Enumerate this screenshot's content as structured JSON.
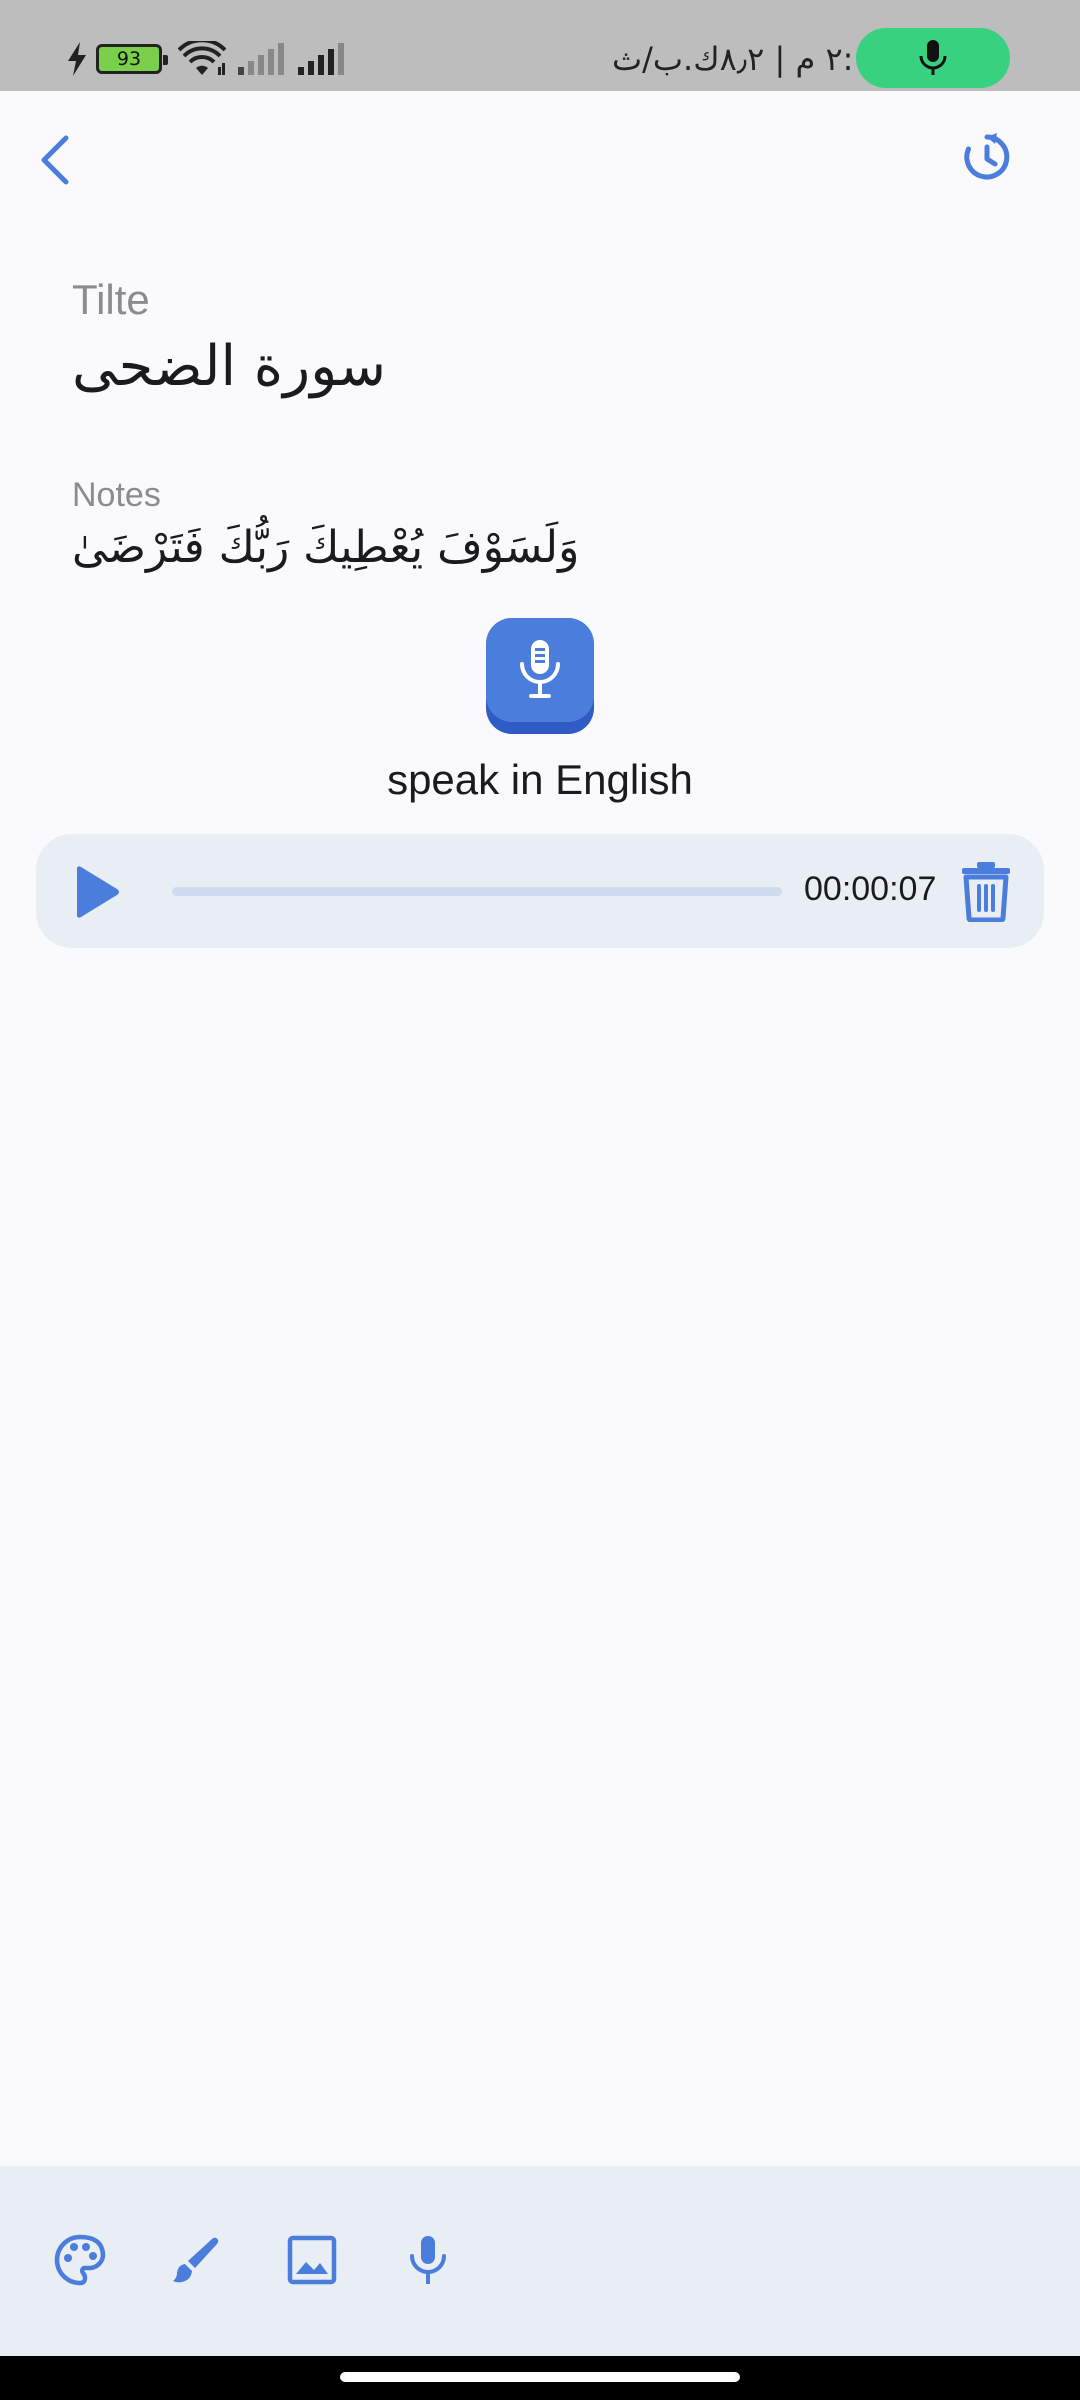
{
  "status_bar": {
    "battery_level": "93",
    "time_text": "٢:١٨ م | ٨٫٢ك.ب/ث",
    "mic_active_color": "#38d180"
  },
  "app_bar": {
    "back_icon": "chevron-left-icon",
    "history_icon": "history-icon"
  },
  "note": {
    "title_label": "Tilte",
    "title_value": "سورة الضحى",
    "notes_label": "Notes",
    "notes_value": "وَلَسَوْفَ يُعْطِيكَ رَبُّكَ فَتَرْضَىٰ"
  },
  "recorder": {
    "speak_label": "speak in English",
    "mic_icon": "microphone-icon"
  },
  "audio_player": {
    "duration": "00:00:07",
    "progress": 0,
    "play_icon": "play-icon",
    "delete_icon": "trash-icon"
  },
  "toolbar": {
    "items": [
      {
        "icon": "palette-icon"
      },
      {
        "icon": "brush-icon"
      },
      {
        "icon": "image-icon"
      },
      {
        "icon": "microphone-icon"
      }
    ]
  },
  "colors": {
    "accent": "#4a7ddc",
    "background": "#fafafd",
    "panel": "#e9edf4"
  }
}
